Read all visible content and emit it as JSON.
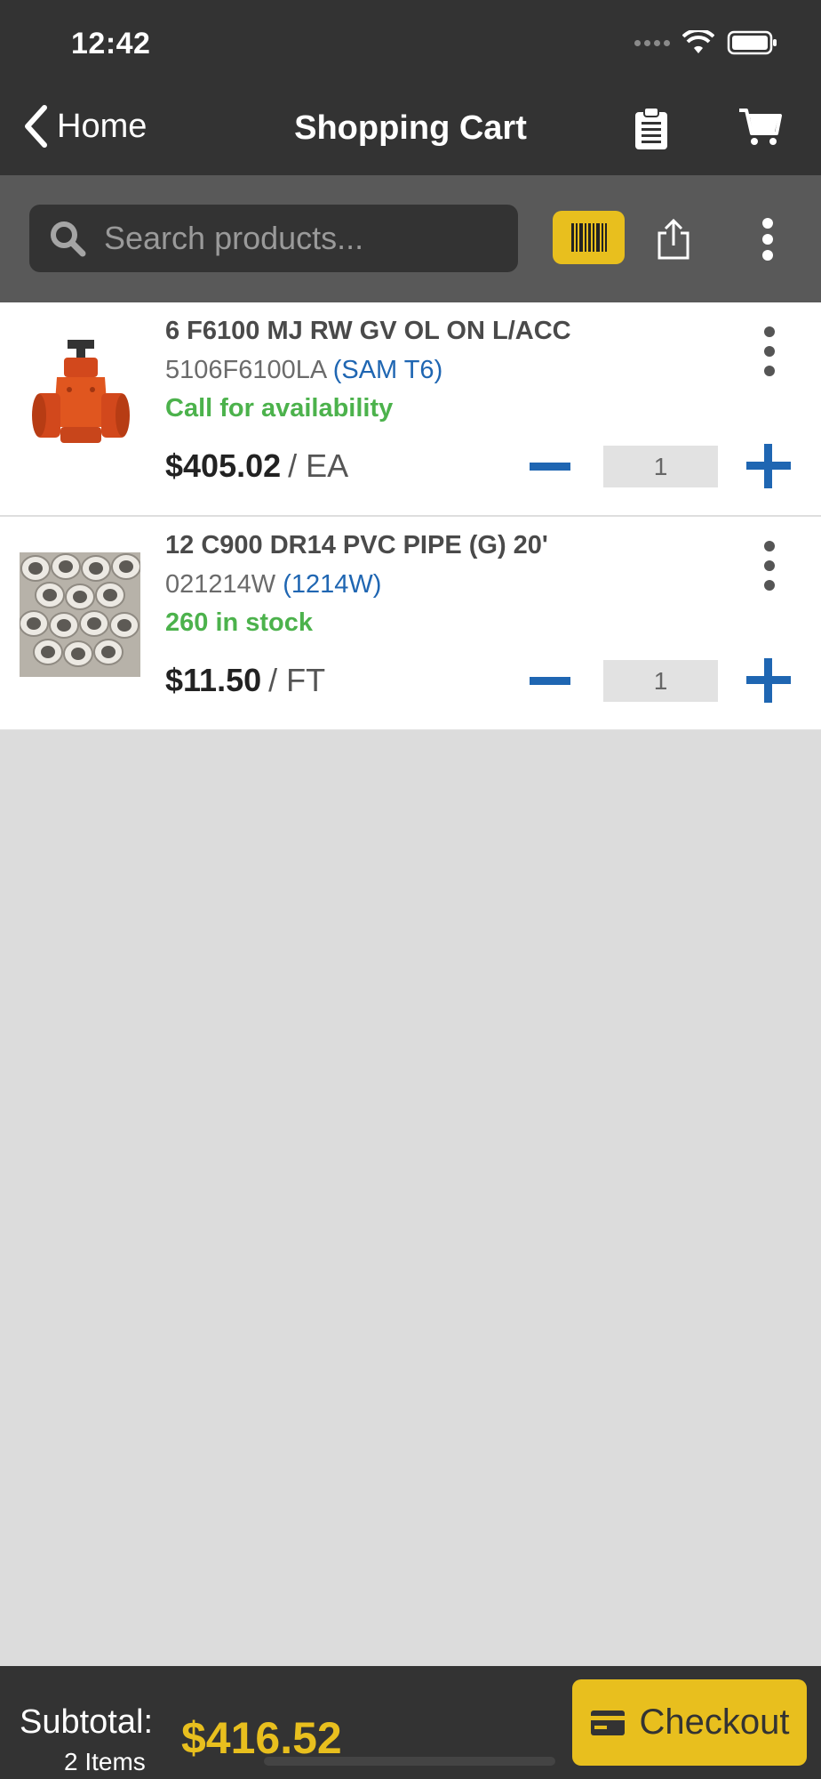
{
  "status_bar": {
    "time": "12:42"
  },
  "nav": {
    "back_label": "Home",
    "title": "Shopping Cart"
  },
  "search": {
    "placeholder": "Search products..."
  },
  "cart_items": [
    {
      "name": "6 F6100 MJ RW GV OL ON L/ACC",
      "sku": "5106F6100LA",
      "alt_code": "(SAM T6)",
      "stock": "Call for availability",
      "price": "$405.02",
      "unit": "/ EA",
      "quantity": "1",
      "image": "gate-valve-image"
    },
    {
      "name": "12 C900 DR14 PVC PIPE (G) 20'",
      "sku": "021214W",
      "alt_code": "(1214W)",
      "stock": "260 in stock",
      "price": "$11.50",
      "unit": "/ FT",
      "quantity": "1",
      "image": "pvc-pipe-image"
    }
  ],
  "footer": {
    "subtotal_label": "Subtotal:",
    "items_count": "2 Items",
    "subtotal_amount": "$416.52",
    "checkout_label": "Checkout"
  },
  "colors": {
    "bar_dark": "#333333",
    "search_bar": "#595959",
    "accent_yellow": "#e8bf1e",
    "link_blue": "#1f66b2",
    "stock_green": "#4cb24c",
    "page_background": "#dcdcdc"
  }
}
